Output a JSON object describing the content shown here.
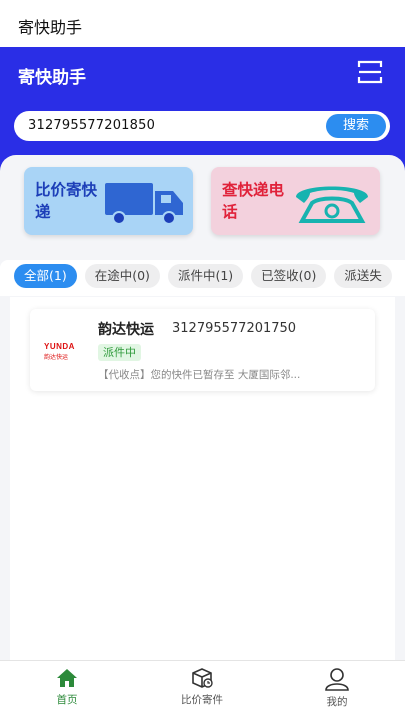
{
  "status_bar": {
    "title": "寄快助手"
  },
  "header": {
    "title": "寄快助手",
    "scan_icon": "scan-icon"
  },
  "search": {
    "value": "312795577201850",
    "button_label": "搜索"
  },
  "cards": {
    "compare": {
      "label": "比价寄快递",
      "icon": "truck-icon"
    },
    "phone": {
      "label": "查快递电话",
      "icon": "telephone-icon"
    }
  },
  "tabs": [
    {
      "label": "全部(1)",
      "active": true
    },
    {
      "label": "在途中(0)"
    },
    {
      "label": "派件中(1)"
    },
    {
      "label": "已签收(0)"
    },
    {
      "label": "派送失"
    }
  ],
  "shipments": [
    {
      "carrier": "韵达快运",
      "logo_text": "YUNDA",
      "logo_subtext": "韵达快运",
      "tracking_number": "312795577201750",
      "status": "派件中",
      "latest": "【代收点】您的快件已暂存至 大厦国际邻..."
    }
  ],
  "bottom_nav": [
    {
      "label": "首页",
      "icon": "home-icon",
      "active": true
    },
    {
      "label": "比价寄件",
      "icon": "package-icon"
    },
    {
      "label": "我的",
      "icon": "user-icon"
    }
  ],
  "colors": {
    "brand_blue": "#2a2ee6",
    "accent_blue": "#2c8df0",
    "active_green": "#2c8a3a"
  }
}
